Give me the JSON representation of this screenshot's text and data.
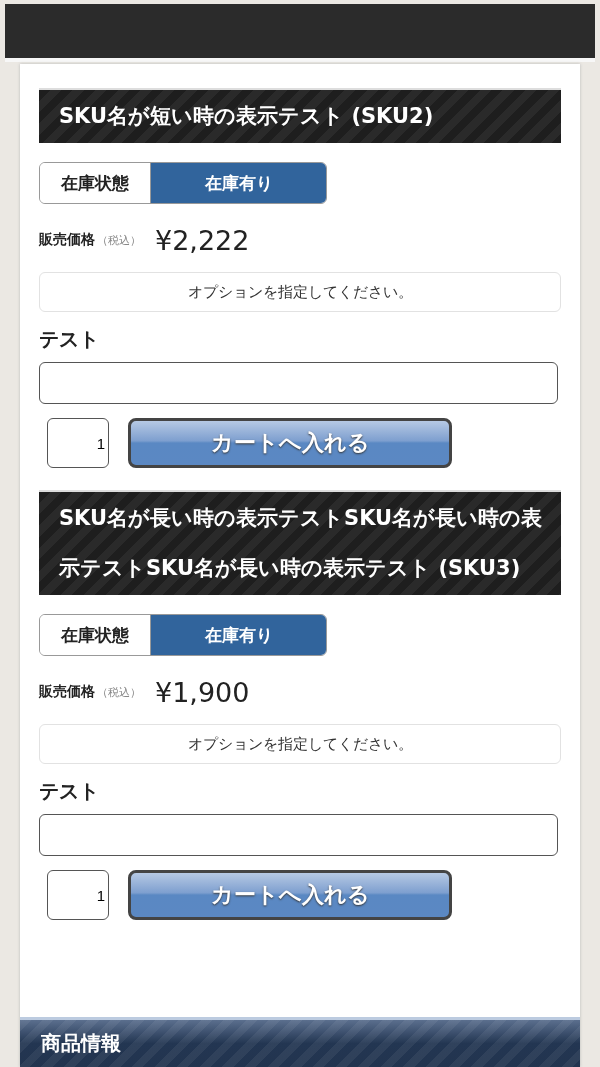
{
  "skus": [
    {
      "title": "SKU名が短い時の表示テスト (SKU2)",
      "stock_label": "在庫状態",
      "stock_value": "在庫有り",
      "price_label": "販売価格",
      "tax_note": "（税込）",
      "price": "¥2,222",
      "option_notice": "オプションを指定してください。",
      "option_label": "テスト",
      "quantity": "1",
      "cart_button": "カートへ入れる"
    },
    {
      "title": "SKU名が長い時の表示テストSKU名が長い時の表示テストSKU名が長い時の表示テスト (SKU3)",
      "stock_label": "在庫状態",
      "stock_value": "在庫有り",
      "price_label": "販売価格",
      "tax_note": "（税込）",
      "price": "¥1,900",
      "option_notice": "オプションを指定してください。",
      "option_label": "テスト",
      "quantity": "1",
      "cart_button": "カートへ入れる"
    }
  ],
  "section_header": "商品情報"
}
